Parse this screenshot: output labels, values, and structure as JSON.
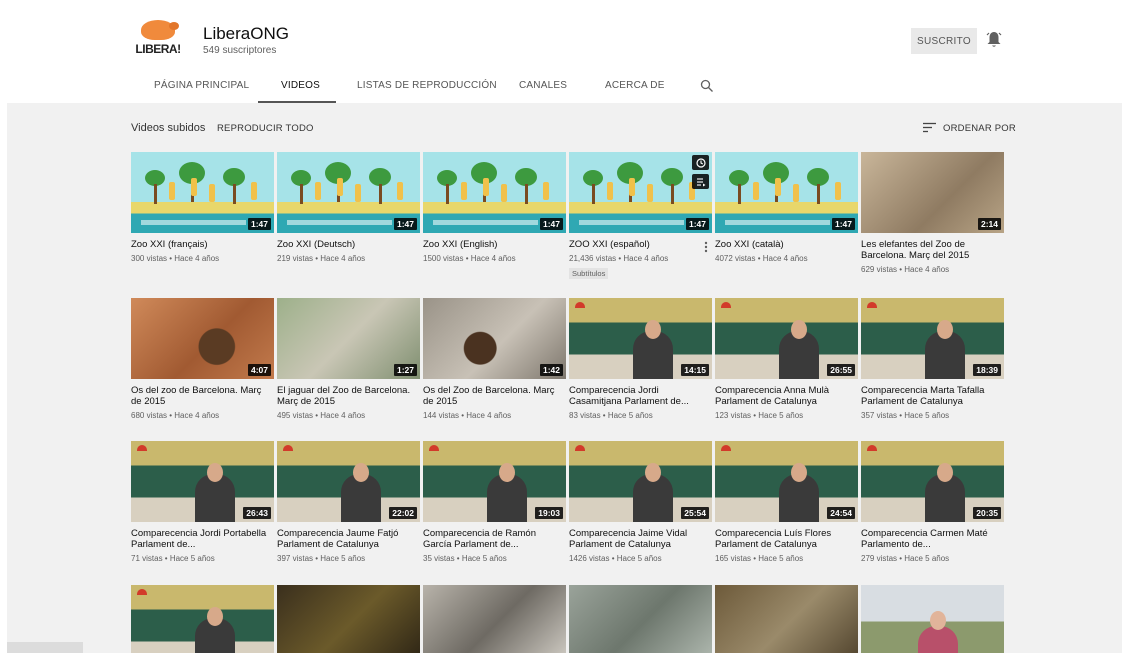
{
  "channel": {
    "logo_text": "LIBERA!",
    "name": "LiberaONG",
    "subscribers": "549 suscriptores",
    "subscribe_label": "SUSCRITO"
  },
  "tabs": [
    {
      "label": "PÁGINA PRINCIPAL",
      "active": false
    },
    {
      "label": "VIDEOS",
      "active": true
    },
    {
      "label": "LISTAS DE REPRODUCCIÓN",
      "active": false
    },
    {
      "label": "CANALES",
      "active": false
    },
    {
      "label": "ACERCA DE",
      "active": false
    }
  ],
  "section": {
    "title": "Videos subidos",
    "play_all": "REPRODUCIR TODO",
    "sort_label": "ORDENAR POR"
  },
  "videos": [
    {
      "title": "Zoo XXI (français)",
      "meta": "300 vistas • Hace 4 años",
      "duration": "1:47",
      "thumb": "zoo"
    },
    {
      "title": "Zoo XXI (Deutsch)",
      "meta": "219 vistas • Hace 4 años",
      "duration": "1:47",
      "thumb": "zoo"
    },
    {
      "title": "Zoo XXI (English)",
      "meta": "1500 vistas • Hace 4 años",
      "duration": "1:47",
      "thumb": "zoo"
    },
    {
      "title": "ZOO XXI (español)",
      "meta": "21,436 vistas • Hace 4 años",
      "duration": "1:47",
      "thumb": "zoo",
      "badge": "Subtítulos"
    },
    {
      "title": "Zoo XXI (català)",
      "meta": "4072 vistas • Hace 4 años",
      "duration": "1:47",
      "thumb": "zoo"
    },
    {
      "title": "Les elefantes del Zoo de Barcelona. Març del 2015",
      "meta": "629 vistas • Hace 4 años",
      "duration": "2:14",
      "thumb": "elephant"
    },
    {
      "title": "Os del zoo de Barcelona. Març de 2015",
      "meta": "680 vistas • Hace 4 años",
      "duration": "4:07",
      "thumb": "bear1"
    },
    {
      "title": "El jaguar del Zoo de Barcelona. Març de 2015",
      "meta": "495 vistas • Hace 4 años",
      "duration": "1:27",
      "thumb": "jaguar"
    },
    {
      "title": "Os del Zoo de Barcelona. Març de 2015",
      "meta": "144 vistas • Hace 4 años",
      "duration": "1:42",
      "thumb": "bear2"
    },
    {
      "title": "Comparecencia Jordi Casamitjana Parlament de...",
      "meta": "83 vistas • Hace 5 años",
      "duration": "14:15",
      "thumb": "parl"
    },
    {
      "title": "Comparecencia Anna Mulà Parlament de Catalunya",
      "meta": "123 vistas • Hace 5 años",
      "duration": "26:55",
      "thumb": "parl"
    },
    {
      "title": "Comparecencia Marta Tafalla Parlament de Catalunya",
      "meta": "357 vistas • Hace 5 años",
      "duration": "18:39",
      "thumb": "parl"
    },
    {
      "title": "Comparecencia Jordi Portabella Parlament de...",
      "meta": "71 vistas • Hace 5 años",
      "duration": "26:43",
      "thumb": "parl"
    },
    {
      "title": "Comparecencia Jaume Fatjó Parlament de Catalunya",
      "meta": "397 vistas • Hace 5 años",
      "duration": "22:02",
      "thumb": "parl"
    },
    {
      "title": "Comparecencia de Ramón García Parlament de...",
      "meta": "35 vistas • Hace 5 años",
      "duration": "19:03",
      "thumb": "parl"
    },
    {
      "title": "Comparecencia Jaime Vidal Parlament de Catalunya",
      "meta": "1426 vistas • Hace 5 años",
      "duration": "25:54",
      "thumb": "parl"
    },
    {
      "title": "Comparecencia Luís Flores Parlament de Catalunya",
      "meta": "165 vistas • Hace 5 años",
      "duration": "24:54",
      "thumb": "parl"
    },
    {
      "title": "Comparecencia Carmen Maté Parlamento de...",
      "meta": "279 vistas • Hace 5 años",
      "duration": "20:35",
      "thumb": "parl"
    },
    {
      "title": "",
      "meta": "",
      "duration": "",
      "thumb": "parl"
    },
    {
      "title": "",
      "meta": "",
      "duration": "",
      "thumb": "dark"
    },
    {
      "title": "",
      "meta": "",
      "duration": "",
      "thumb": "people"
    },
    {
      "title": "",
      "meta": "",
      "duration": "",
      "thumb": "giraffe"
    },
    {
      "title": "",
      "meta": "",
      "duration": "",
      "thumb": "animal"
    },
    {
      "title": "",
      "meta": "",
      "duration": "",
      "thumb": "woman"
    }
  ],
  "status_bar": "",
  "colors": {
    "background": "#f1f1f1",
    "header": "#ffffff",
    "duration_badge": "#000000",
    "brand_orange": "#e2762a"
  }
}
